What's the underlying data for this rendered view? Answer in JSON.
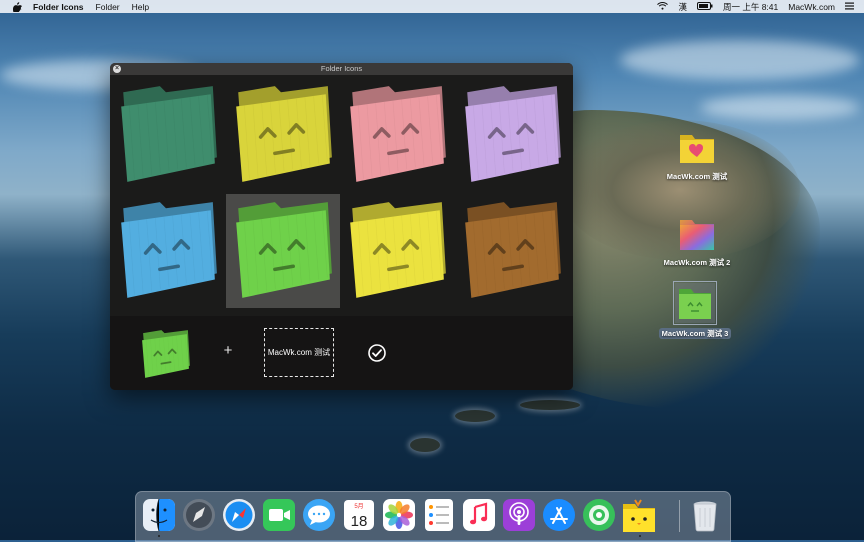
{
  "menubar": {
    "app_name": "Folder Icons",
    "menus": [
      "Folder",
      "Help"
    ],
    "status": {
      "input_method": "漢",
      "datetime": "周一 上午 8:41",
      "username": "MacWk.com"
    }
  },
  "window": {
    "title": "Folder Icons",
    "grid_colors": [
      "#3f8d6d",
      "#d9d43b",
      "#ec9aa1",
      "#c8a9e6",
      "#53aee0",
      "#6fd14a",
      "#ebe23f",
      "#a26b2e"
    ],
    "selected_index": 5,
    "plus": "+",
    "drop_label": "MacWk.com 测试"
  },
  "desktop": {
    "icons": [
      {
        "label": "MacWk.com 测试"
      },
      {
        "label": "MacWk.com 测试 2"
      },
      {
        "label": "MacWk.com 测试 3"
      }
    ]
  },
  "dock": {
    "calendar_month": "5月",
    "calendar_day": "18",
    "items": [
      "finder-icon",
      "launchpad-icon",
      "safari-icon",
      "facetime-icon",
      "messages-icon",
      "calendar-icon",
      "photos-icon",
      "reminders-icon",
      "music-icon",
      "podcasts-icon",
      "app-store-icon",
      "find-my-icon",
      "folder-icons-app-icon",
      "trash-icon"
    ]
  }
}
